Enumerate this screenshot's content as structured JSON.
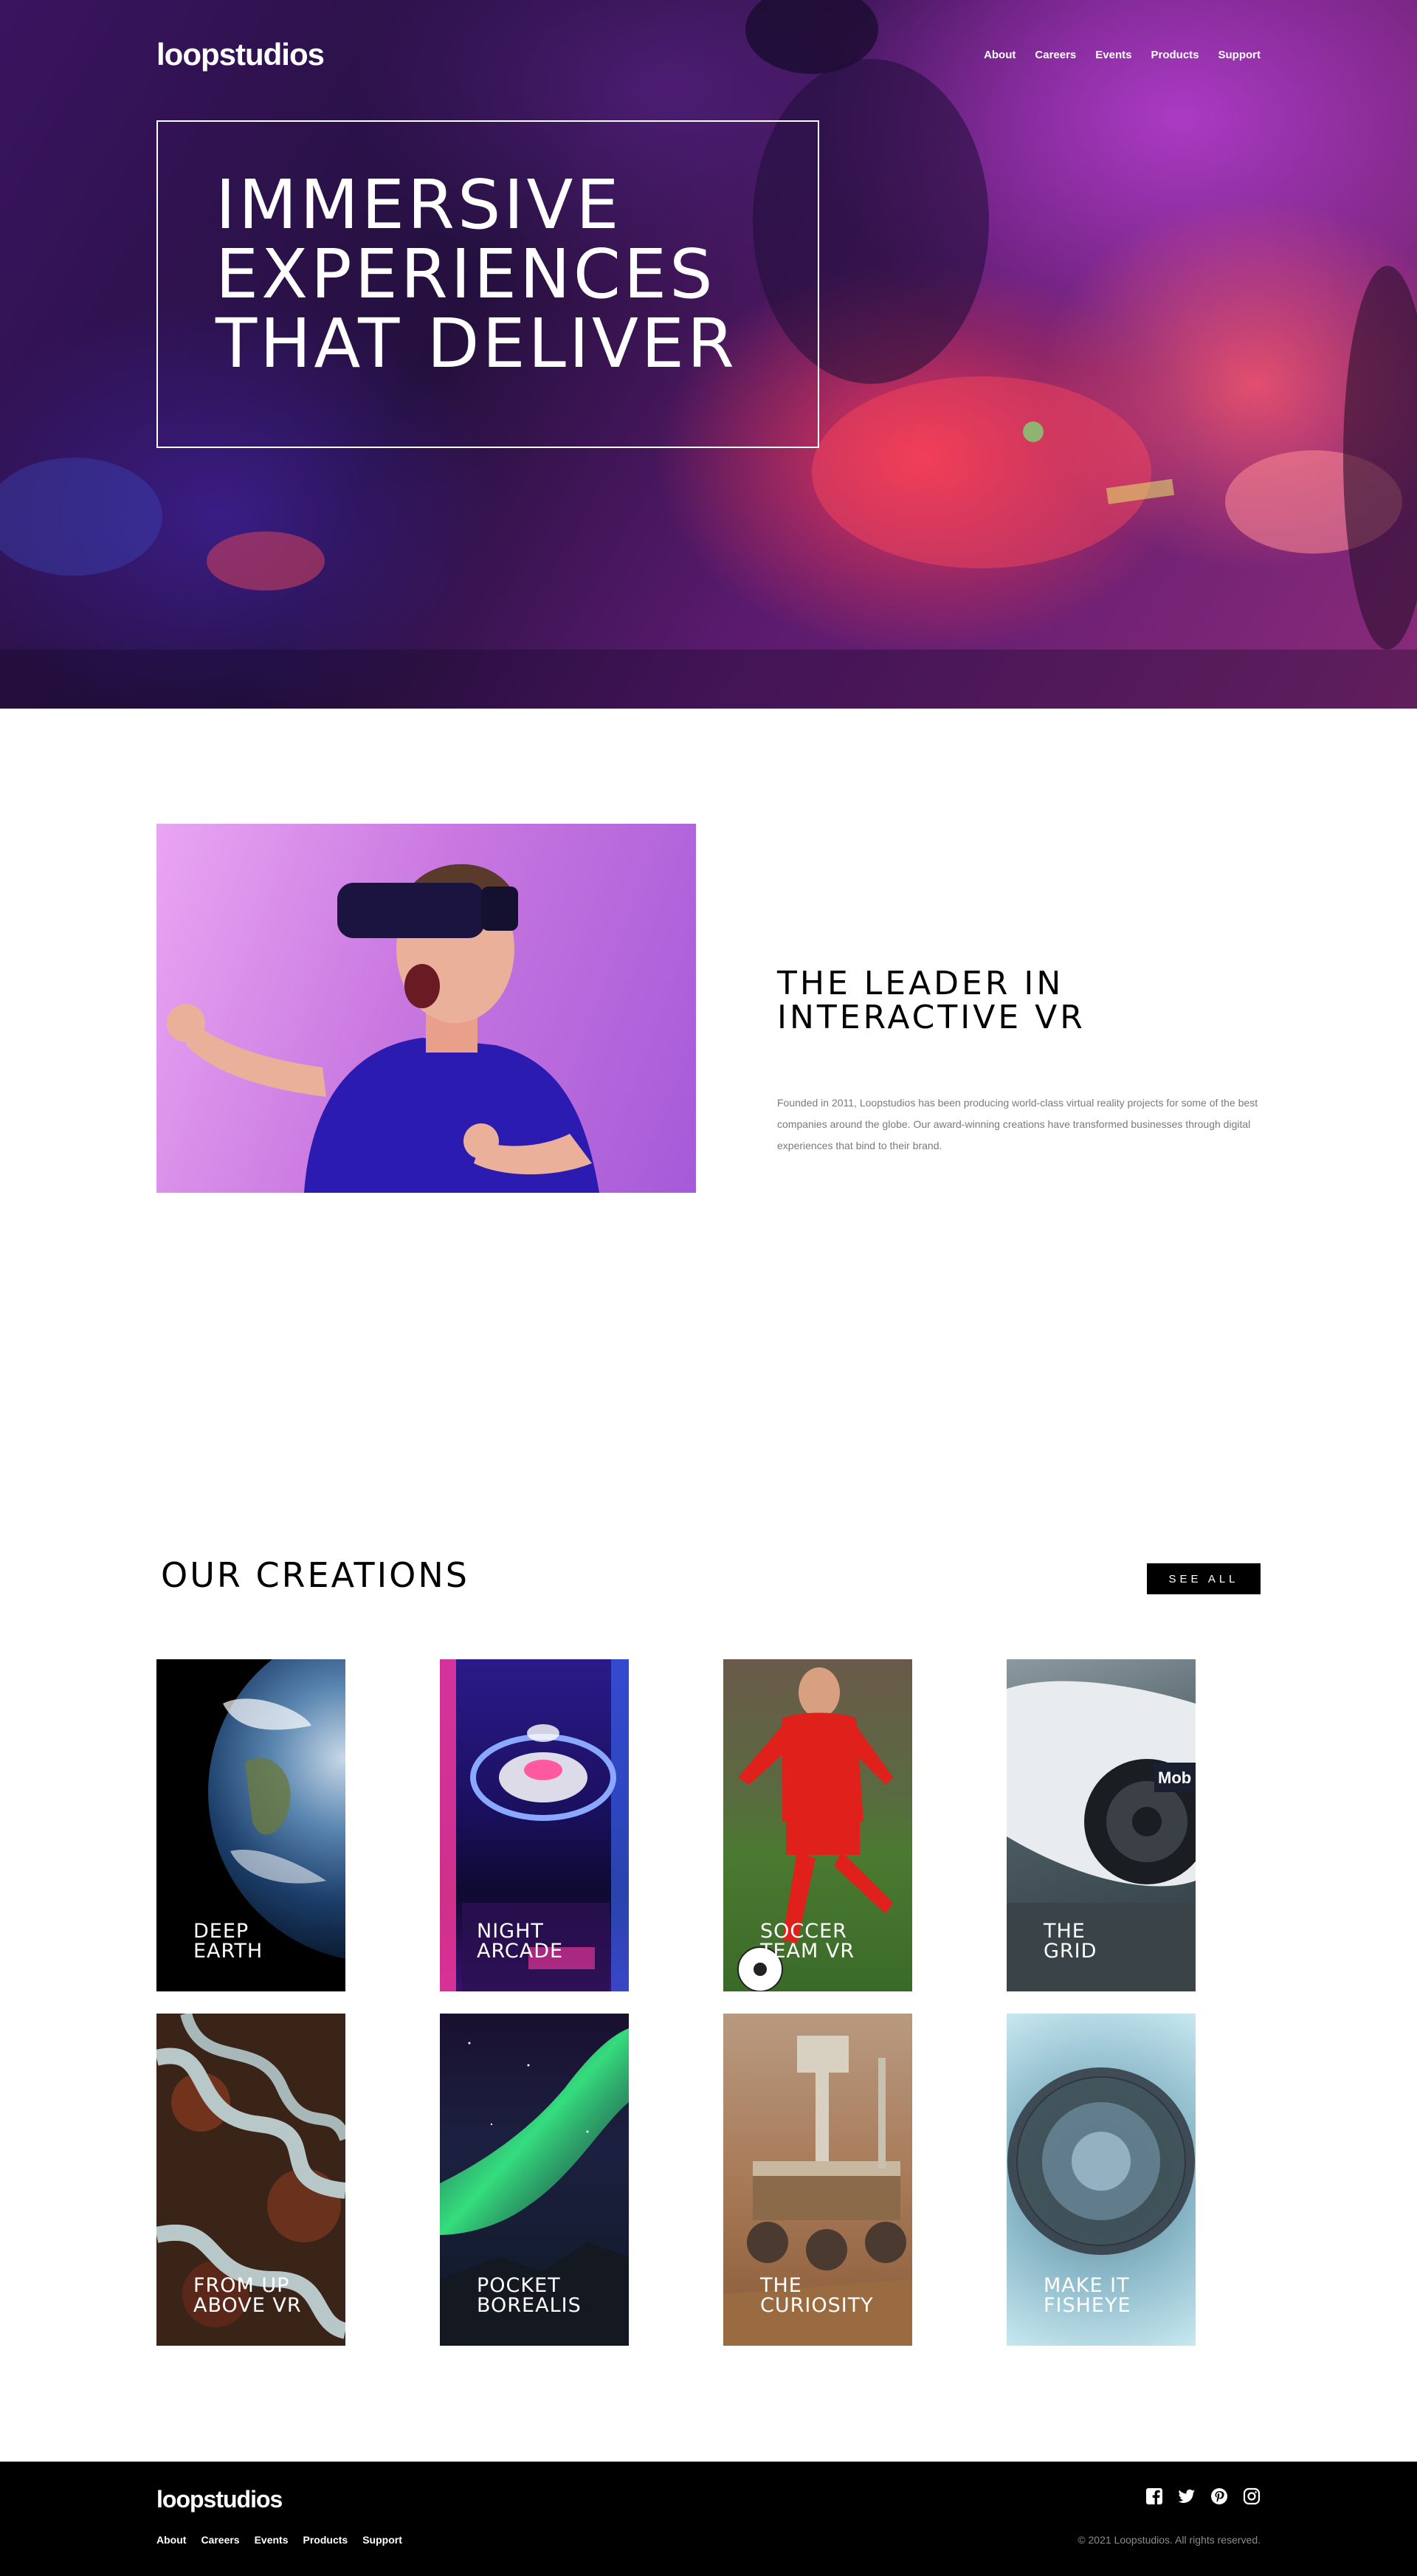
{
  "header": {
    "logo": "loopstudios",
    "nav": [
      "About",
      "Careers",
      "Events",
      "Products",
      "Support"
    ]
  },
  "hero": {
    "title_lines": [
      "IMMERSIVE",
      "EXPERIENCES",
      "THAT DELIVER"
    ]
  },
  "about": {
    "title_lines": [
      "THE LEADER IN",
      "INTERACTIVE VR"
    ],
    "description": "Founded in 2011, Loopstudios has been producing world-class virtual reality projects for some of the best companies around the globe. Our award-winning creations have transformed businesses through digital experiences that bind to their brand."
  },
  "creations": {
    "title": "OUR CREATIONS",
    "see_all": "SEE ALL",
    "items": [
      {
        "lines": [
          "DEEP",
          "EARTH"
        ],
        "icon": "earth-image"
      },
      {
        "lines": [
          "NIGHT",
          "ARCADE"
        ],
        "icon": "arcade-image"
      },
      {
        "lines": [
          "SOCCER",
          "TEAM VR"
        ],
        "icon": "soccer-image"
      },
      {
        "lines": [
          "THE",
          "GRID"
        ],
        "icon": "car-image"
      },
      {
        "lines": [
          "FROM UP",
          "ABOVE VR"
        ],
        "icon": "aerial-road-image"
      },
      {
        "lines": [
          "POCKET",
          "BOREALIS"
        ],
        "icon": "aurora-image"
      },
      {
        "lines": [
          "THE",
          "CURIOSITY"
        ],
        "icon": "rover-image"
      },
      {
        "lines": [
          "MAKE IT",
          "FISHEYE"
        ],
        "icon": "fisheye-image"
      }
    ]
  },
  "footer": {
    "logo": "loopstudios",
    "nav": [
      "About",
      "Careers",
      "Events",
      "Products",
      "Support"
    ],
    "social": [
      "facebook-icon",
      "twitter-icon",
      "pinterest-icon",
      "instagram-icon"
    ],
    "copyright": "© 2021 Loopstudios. All rights reserved."
  }
}
